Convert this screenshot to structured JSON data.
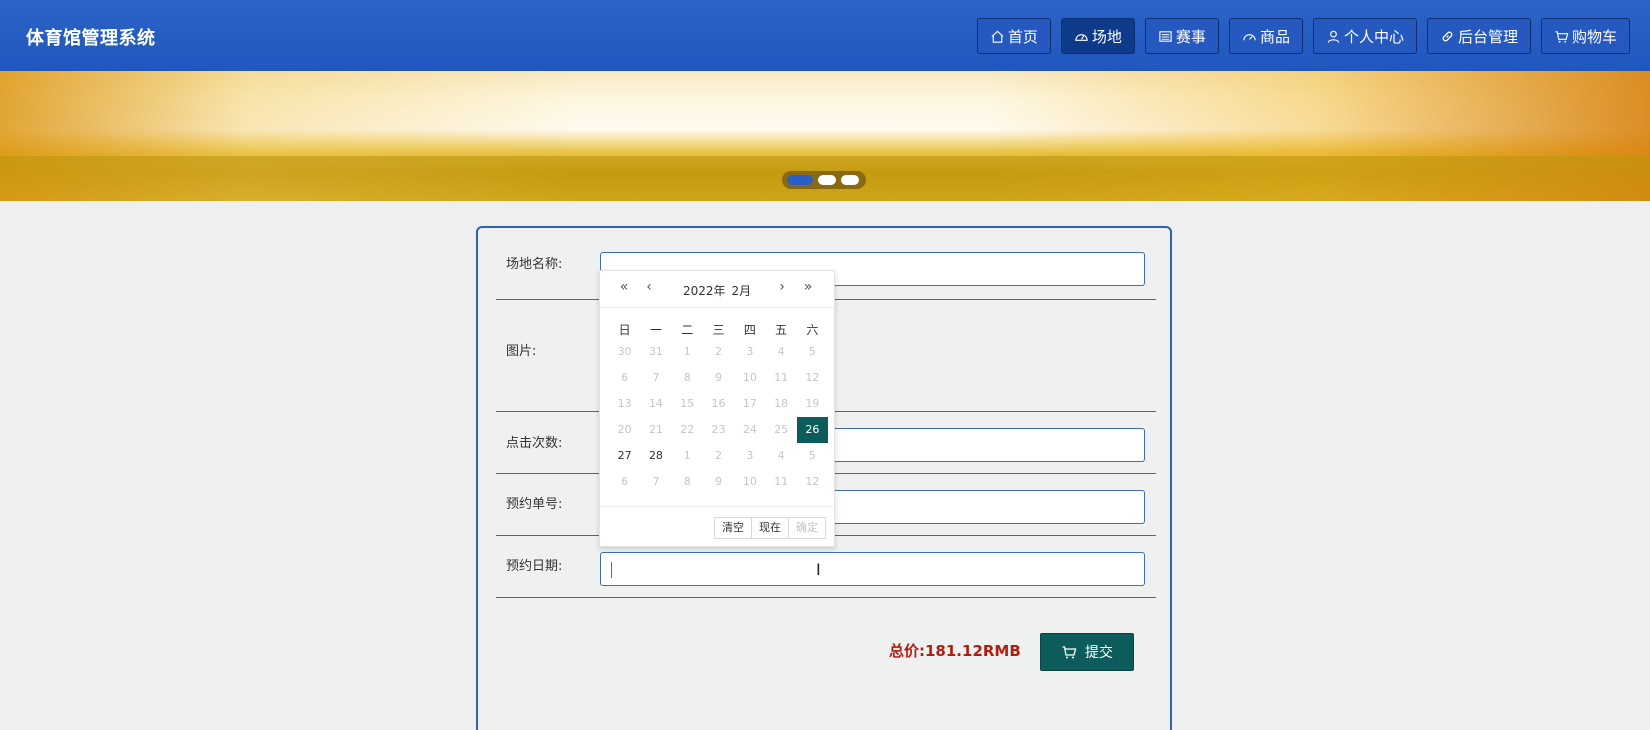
{
  "header": {
    "brand": "体育馆管理系统",
    "nav": [
      {
        "label": "首页",
        "icon": "home-icon"
      },
      {
        "label": "场地",
        "icon": "dashboard-icon",
        "active": true
      },
      {
        "label": "赛事",
        "icon": "list-icon"
      },
      {
        "label": "商品",
        "icon": "gauge-icon"
      },
      {
        "label": "个人中心",
        "icon": "user-icon"
      },
      {
        "label": "后台管理",
        "icon": "link-icon"
      },
      {
        "label": "购物车",
        "icon": "cart-icon"
      }
    ]
  },
  "banner": {
    "slides": 3,
    "active_slide": 1
  },
  "form": {
    "venue_name_label": "场地名称:",
    "image_label": "图片:",
    "clicks_label": "点击次数:",
    "order_no_label": "预约单号:",
    "date_label": "预约日期:",
    "total_label": "总价:",
    "total_value": "181.12RMB",
    "submit_label": "提交"
  },
  "datepicker": {
    "year": "2022年",
    "month": "2月",
    "weekdays": [
      "日",
      "一",
      "二",
      "三",
      "四",
      "五",
      "六"
    ],
    "days": [
      {
        "d": "30",
        "cur": false
      },
      {
        "d": "31",
        "cur": false
      },
      {
        "d": "1",
        "cur": false
      },
      {
        "d": "2",
        "cur": false
      },
      {
        "d": "3",
        "cur": false
      },
      {
        "d": "4",
        "cur": false
      },
      {
        "d": "5",
        "cur": false
      },
      {
        "d": "6",
        "cur": false
      },
      {
        "d": "7",
        "cur": false
      },
      {
        "d": "8",
        "cur": false
      },
      {
        "d": "9",
        "cur": false
      },
      {
        "d": "10",
        "cur": false
      },
      {
        "d": "11",
        "cur": false
      },
      {
        "d": "12",
        "cur": false
      },
      {
        "d": "13",
        "cur": false
      },
      {
        "d": "14",
        "cur": false
      },
      {
        "d": "15",
        "cur": false
      },
      {
        "d": "16",
        "cur": false
      },
      {
        "d": "17",
        "cur": false
      },
      {
        "d": "18",
        "cur": false
      },
      {
        "d": "19",
        "cur": false
      },
      {
        "d": "20",
        "cur": false
      },
      {
        "d": "21",
        "cur": false
      },
      {
        "d": "22",
        "cur": false
      },
      {
        "d": "23",
        "cur": false
      },
      {
        "d": "24",
        "cur": false
      },
      {
        "d": "25",
        "cur": false
      },
      {
        "d": "26",
        "cur": true,
        "selected": true
      },
      {
        "d": "27",
        "cur": true
      },
      {
        "d": "28",
        "cur": true
      },
      {
        "d": "1",
        "cur": false
      },
      {
        "d": "2",
        "cur": false
      },
      {
        "d": "3",
        "cur": false
      },
      {
        "d": "4",
        "cur": false
      },
      {
        "d": "5",
        "cur": false
      },
      {
        "d": "6",
        "cur": false
      },
      {
        "d": "7",
        "cur": false
      },
      {
        "d": "8",
        "cur": false
      },
      {
        "d": "9",
        "cur": false
      },
      {
        "d": "10",
        "cur": false
      },
      {
        "d": "11",
        "cur": false
      },
      {
        "d": "12",
        "cur": false
      }
    ],
    "clear_label": "清空",
    "now_label": "现在",
    "confirm_label": "确定"
  },
  "colors": {
    "header": "#2b63c6",
    "accent": "#0d5c5c",
    "price": "#b51c10"
  }
}
